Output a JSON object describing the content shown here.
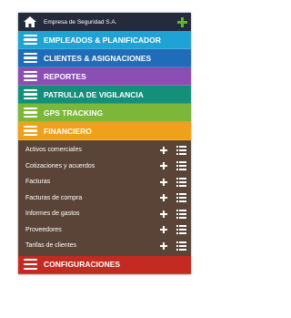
{
  "topbar": {
    "company": "Empresa de Seguridad S.A.",
    "home_icon": "home-icon",
    "add_icon": "plus-icon",
    "add_icon_color": "#62b62b"
  },
  "menu": [
    {
      "label": "EMPLEADOS & PLANIFICADOR",
      "color": "#1fa3d4"
    },
    {
      "label": "CLIENTES & ASIGNACIONES",
      "color": "#1f6db8"
    },
    {
      "label": "REPORTES",
      "color": "#8a4fb2"
    },
    {
      "label": "PATRULLA DE VIGILANCIA",
      "color": "#14907a"
    },
    {
      "label": "GPS TRACKING",
      "color": "#7cb73a"
    },
    {
      "label": "FINANCIERO",
      "color": "#f0a11c"
    }
  ],
  "submenu": {
    "background": "#5a4438",
    "items": [
      {
        "label": "Activos comerciales"
      },
      {
        "label": "Cotizaciones y acuerdos"
      },
      {
        "label": "Facturas"
      },
      {
        "label": "Facturas de compra"
      },
      {
        "label": "Informes de gastos"
      },
      {
        "label": "Proveedores"
      },
      {
        "label": "Tarifas de clientes"
      }
    ]
  },
  "config": {
    "label": "CONFIGURACIONES",
    "color": "#c42a21"
  }
}
